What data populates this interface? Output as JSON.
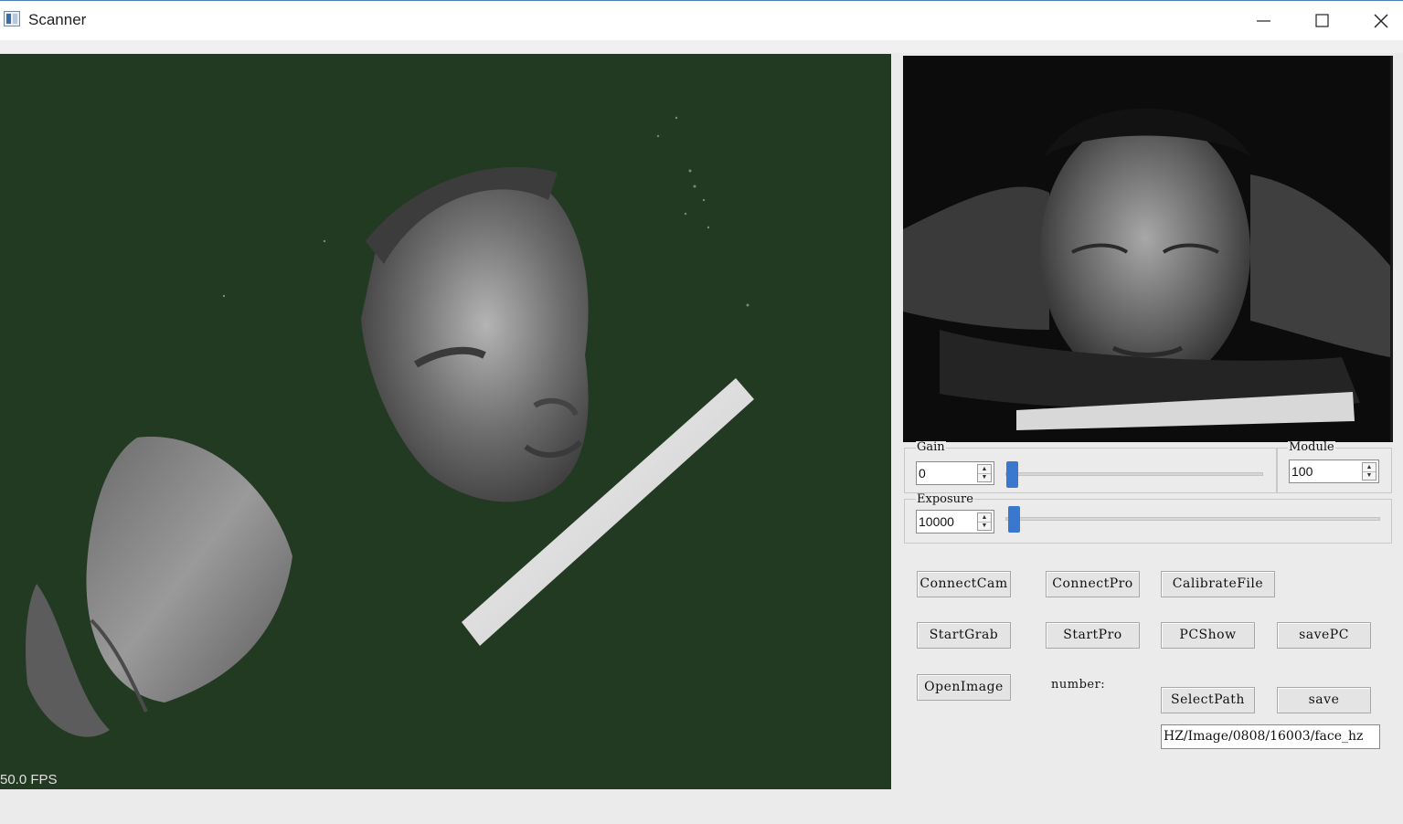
{
  "window": {
    "title": "Scanner",
    "controls": [
      "minimize-icon",
      "maximize-icon",
      "close-icon"
    ]
  },
  "viewport3d": {
    "background_color": "#223a22",
    "fps_label": "50.0 FPS"
  },
  "camera_view": {
    "description_icon": "camera-feed-image"
  },
  "controls": {
    "gain": {
      "label": "Gain",
      "value": "0",
      "slider_level": 0
    },
    "module": {
      "label": "Module",
      "value": "100"
    },
    "exposure": {
      "label": "Exposure",
      "value": "10000",
      "slider_level": 0
    }
  },
  "buttons": {
    "connect_cam": "ConnectCam",
    "connect_pro": "ConnectPro",
    "calibrate_file": "CalibrateFile",
    "start_grab": "StartGrab",
    "start_pro": "StartPro",
    "pc_show": "PCShow",
    "save_pc": "savePC",
    "open_image": "OpenImage",
    "select_path": "SelectPath",
    "save": "save"
  },
  "number_label": "number:",
  "path_value": "HZ/Image/0808/16003/face_hz",
  "colors": {
    "slider_handle": "#3a78d0",
    "window_background": "#ebebeb"
  }
}
